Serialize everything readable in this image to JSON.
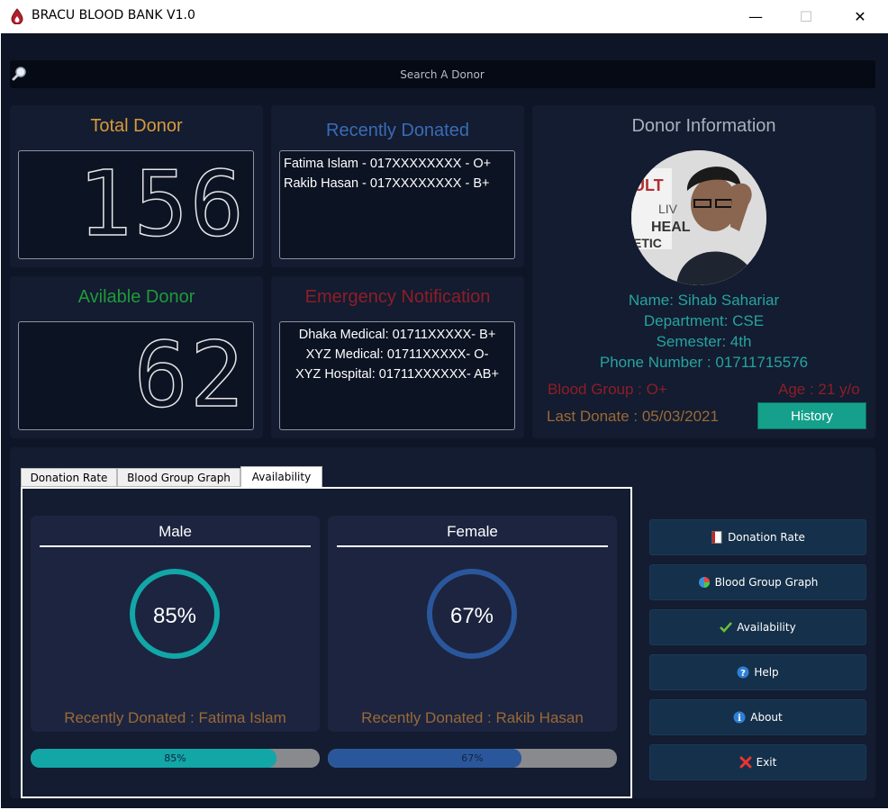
{
  "window": {
    "title": "BRACU BLOOD BANK V1.0",
    "minimize": "—",
    "maximize": "☐",
    "close": "✕"
  },
  "search": {
    "placeholder": "Search A Donor"
  },
  "total_donor": {
    "title": "Total Donor",
    "value": "156"
  },
  "available_donor": {
    "title": "Avilable Donor",
    "value": "62"
  },
  "recently_donated": {
    "title": "Recently Donated",
    "items": [
      "Fatima Islam - 017XXXXXXXX - O+",
      "Rakib Hasan - 017XXXXXXXX - B+"
    ]
  },
  "emergency": {
    "title": "Emergency Notification",
    "items": [
      "Dhaka Medical: 01711XXXXX- B+",
      "XYZ Medical: 01711XXXXX- O-",
      "XYZ Hospital: 01711XXXXXX- AB+"
    ]
  },
  "donor_info": {
    "title": "Donor Information",
    "name": "Name: Sihab Sahariar",
    "department": "Department: CSE",
    "semester": "Semester: 4th",
    "phone": "Phone Number : 01711715576",
    "blood_group": "Blood Group : O+",
    "age": "Age : 21 y/o",
    "last_donate": "Last Donate : 05/03/2021",
    "history_label": "History"
  },
  "tabs": [
    {
      "label": "Donation Rate"
    },
    {
      "label": "Blood Group Graph"
    },
    {
      "label": "Availability"
    }
  ],
  "availability": {
    "male": {
      "title": "Male",
      "percent_label": "85%",
      "percent": 0.85,
      "recent": "Recently Donated : Fatima Islam",
      "color": "#12a6a7"
    },
    "female": {
      "title": "Female",
      "percent_label": "67%",
      "percent": 0.67,
      "recent": "Recently Donated : Rakib Hasan",
      "color": "#2a579c"
    }
  },
  "side_buttons": [
    {
      "label": "Donation Rate",
      "icon": "document-icon"
    },
    {
      "label": "Blood Group Graph",
      "icon": "pie-chart-icon"
    },
    {
      "label": "Availability",
      "icon": "checkmark-icon"
    },
    {
      "label": "Help",
      "icon": "help-icon"
    },
    {
      "label": "About",
      "icon": "info-icon"
    },
    {
      "label": "Exit",
      "icon": "exit-icon"
    }
  ],
  "colors": {
    "background": "#0e1526",
    "panel": "#131c30",
    "total_donor_title": "#d89a3a",
    "available_donor_title": "#1f9a3a",
    "recently_donated_title": "#3a6bb8",
    "emergency_title": "#8f1d27",
    "info_teal": "#27a3a0",
    "history_button": "#15a08b"
  }
}
